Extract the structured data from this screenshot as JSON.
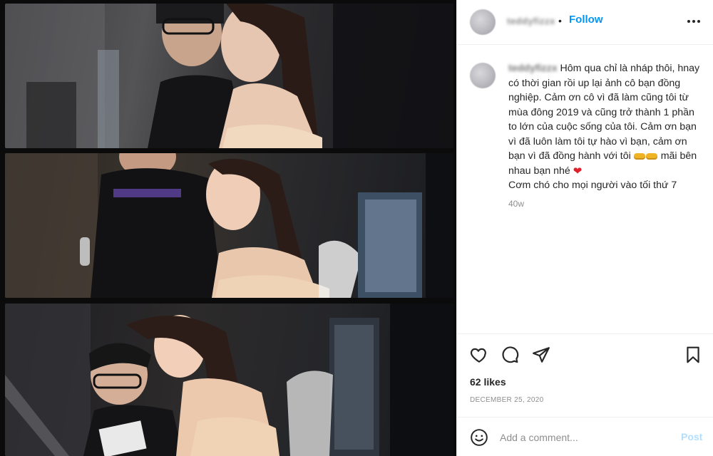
{
  "header": {
    "username": "teddyfizzx",
    "separator": "•",
    "follow_label": "Follow",
    "more_icon": "more-horizontal-icon"
  },
  "caption": {
    "username": "teddyfizzx",
    "text": "Hôm qua chỉ là nháp thôi, hnay có thời gian rồi up lại ảnh cô bạn đồng nghiệp. Cảm ơn cô vì đã làm cũng tôi từ mùa đông 2019 và cũng trở thành 1 phần to lớn của cuộc sống của tôi. Cảm ơn bạn vì đã luôn làm tôi tự hào vì bạn, cảm ơn bạn vì đã đồng hành với tôi",
    "text_end": "mãi bên nhau bạn nhé",
    "line_last": "Cơm chó cho mọi người vào tối thứ 7",
    "time_ago": "40w"
  },
  "actions": {
    "like_icon": "heart-icon",
    "comment_icon": "comment-icon",
    "share_icon": "share-icon",
    "save_icon": "bookmark-icon"
  },
  "likes": "62 likes",
  "date": "December 25, 2020",
  "comment": {
    "emoji_icon": "smiley-icon",
    "placeholder": "Add a comment...",
    "post_label": "Post"
  },
  "colors": {
    "accent": "#0095f6",
    "post_disabled": "#b2dffc",
    "text": "#262626",
    "muted": "#8e8e8e",
    "heart": "#e0202a"
  }
}
